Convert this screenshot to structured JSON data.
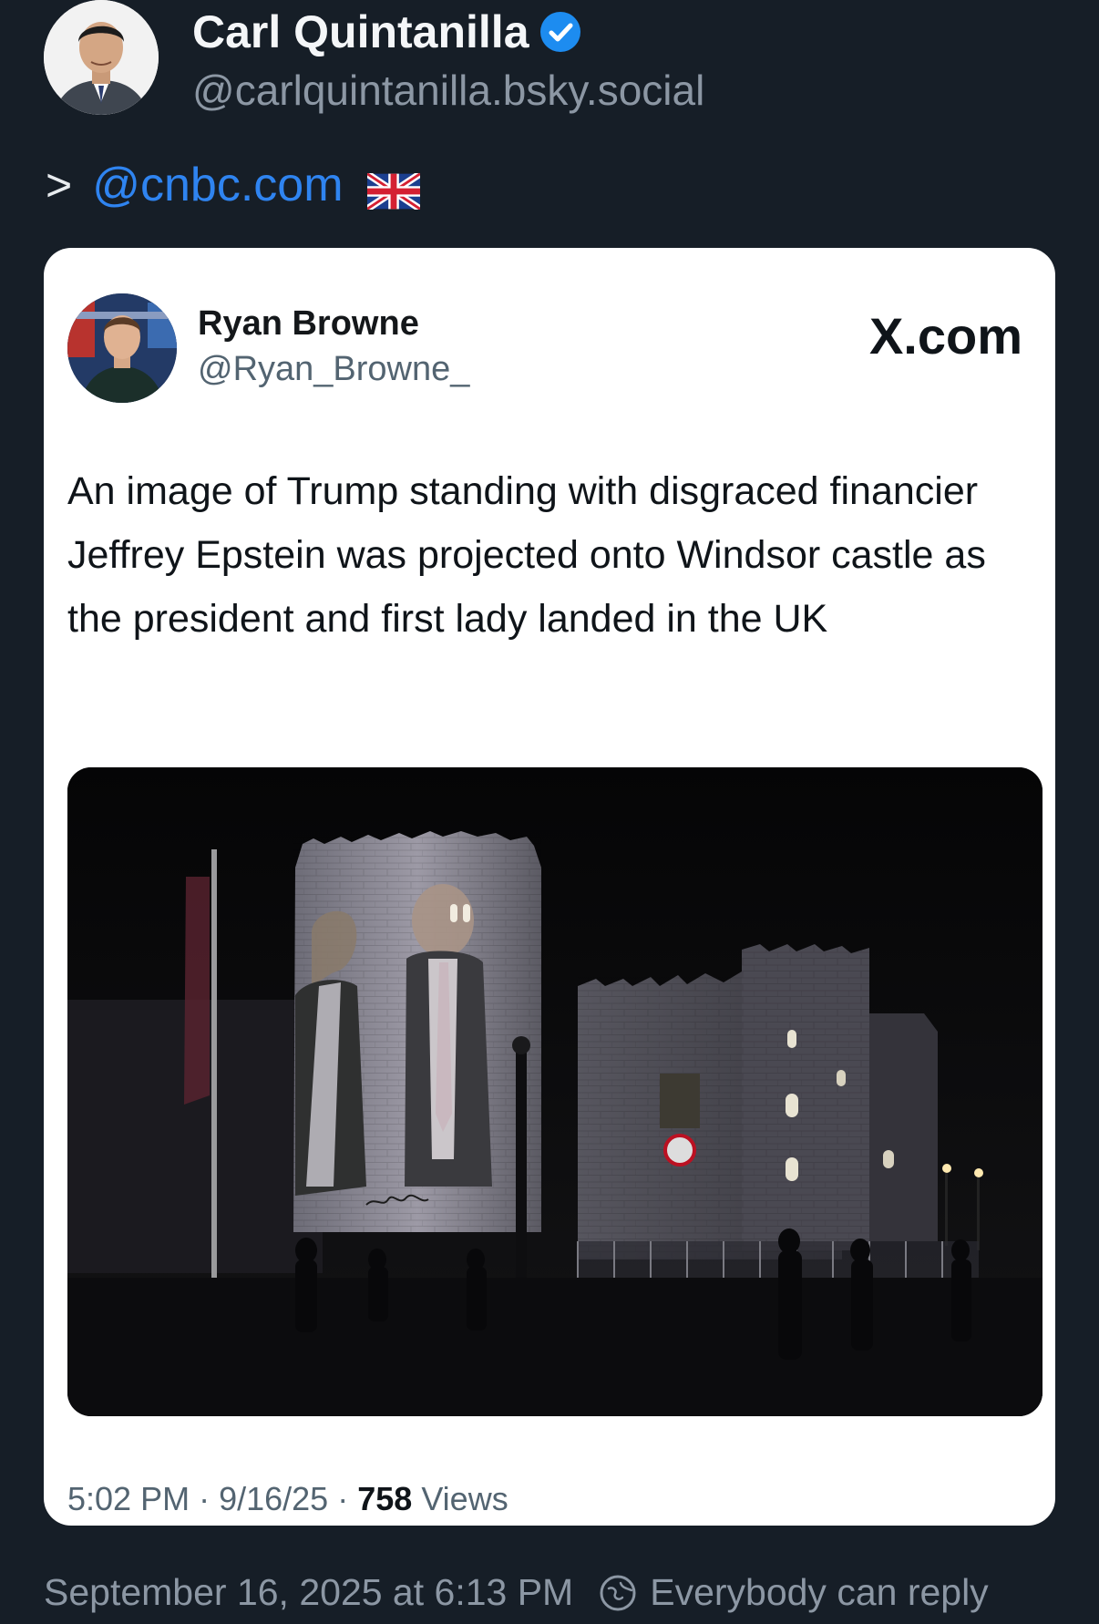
{
  "post": {
    "author_name": "Carl Quintanilla",
    "author_handle": "@carlquintanilla.bsky.social",
    "text_prefix": ">",
    "mention": "@cnbc.com",
    "flag": "uk-flag-emoji",
    "timestamp": "September 16, 2025 at 6:13 PM",
    "reply_setting": "Everybody can reply"
  },
  "embedded_tweet": {
    "author_name": "Ryan Browne",
    "author_handle": "@Ryan_Browne_",
    "source": "X.com",
    "text": "An image of Trump standing with disgraced financier Jeffrey Epstein was projected onto Windsor castle as the president and first lady landed in the UK",
    "time": "5:02 PM",
    "date": "9/16/25",
    "views_count": "758",
    "views_label": "Views"
  },
  "colors": {
    "background": "#161e27",
    "link": "#2f84f0",
    "verified": "#1d8cf0",
    "muted": "#8c97a4"
  }
}
